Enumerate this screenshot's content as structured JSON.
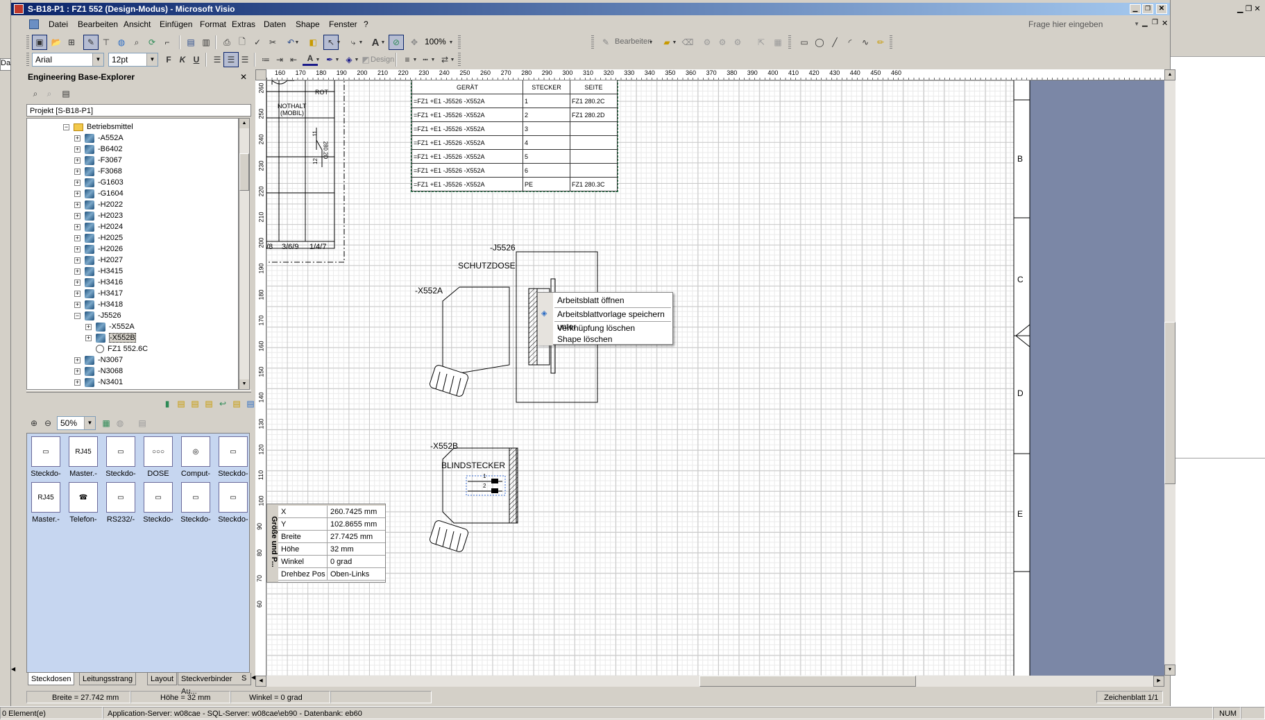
{
  "window": {
    "title": "S-B18-P1 : FZ1 552 (Design-Modus) - Microsoft Visio"
  },
  "menu": {
    "items": [
      "Datei",
      "Bearbeiten",
      "Ansicht",
      "Einfügen",
      "Format",
      "Extras",
      "Daten",
      "Shape",
      "Fenster",
      "?"
    ],
    "help_placeholder": "Frage hier eingeben"
  },
  "toolbar": {
    "zoom": "100%",
    "font": "Arial",
    "font_size": "12pt",
    "bearbeiten_label": "Bearbeiten",
    "design_label": "Design"
  },
  "explorer": {
    "title": "Engineering Base-Explorer",
    "project": "Projekt [S-B18-P1]",
    "root": "Betriebsmittel",
    "items": [
      "-A552A",
      "-B6402",
      "-F3067",
      "-F3068",
      "-G1603",
      "-G1604",
      "-H2022",
      "-H2023",
      "-H2024",
      "-H2025",
      "-H2026",
      "-H2027",
      "-H3415",
      "-H3416",
      "-H3417",
      "-H3418",
      "-J5526"
    ],
    "children": [
      "-X552A",
      "-X552B",
      "FZ1 552.6C"
    ],
    "after": [
      "-N3067",
      "-N3068",
      "-N3401"
    ]
  },
  "stencil": {
    "zoom": "50%",
    "row1": [
      {
        "label": "Steckdo-",
        "icon": "socket-icon"
      },
      {
        "label": "Master.-",
        "icon": "rj45-icon"
      },
      {
        "label": "Steckdo-",
        "icon": "socket-icon"
      },
      {
        "label": "DOSE",
        "icon": "dose-icon"
      },
      {
        "label": "Comput-",
        "icon": "computer-socket-icon"
      },
      {
        "label": "Steckdo-",
        "icon": "socket-icon"
      }
    ],
    "row2": [
      {
        "label": "Master.-",
        "icon": "rj45-icon"
      },
      {
        "label": "Telefon-",
        "icon": "telephone-icon"
      },
      {
        "label": "RS232/-",
        "icon": "rs232-icon"
      },
      {
        "label": "Steckdo-",
        "icon": "socket-icon"
      },
      {
        "label": "Steckdo-",
        "icon": "socket-icon"
      },
      {
        "label": "Steckdo-",
        "icon": "socket-icon"
      }
    ],
    "tabs": [
      "Steckdosen",
      "Leitungsstrang",
      "Layout",
      "Steckverbinder Au...",
      "S"
    ]
  },
  "ruler": {
    "top": [
      "160",
      "170",
      "180",
      "190",
      "200",
      "210",
      "220",
      "230",
      "240",
      "250",
      "260",
      "270",
      "280",
      "290",
      "300",
      "310",
      "320",
      "330",
      "340",
      "350",
      "360",
      "370",
      "380",
      "390",
      "400",
      "410",
      "420",
      "430",
      "440",
      "450",
      "460"
    ],
    "left": [
      "260",
      "250",
      "240",
      "230",
      "220",
      "210",
      "200",
      "190",
      "180",
      "170",
      "160",
      "150",
      "140",
      "130",
      "120",
      "110",
      "100",
      "90",
      "80",
      "70",
      "60"
    ]
  },
  "drawing": {
    "panel": {
      "rot": "ROT",
      "nothalt": "NOTHALT",
      "mobil": "(MOBIL)",
      "n11": "11",
      "n12": "12",
      "ref": "280.2D",
      "f1": "/8",
      "f2": "3/6/9",
      "f3": "1/4/7"
    },
    "table": {
      "headers": [
        "GERÄT",
        "STECKER",
        "SEITE"
      ],
      "rows": [
        [
          "=FZ1 +E1 -J5526 -X552A",
          "1",
          "FZ1 280.2C"
        ],
        [
          "=FZ1 +E1 -J5526 -X552A",
          "2",
          "FZ1 280.2D"
        ],
        [
          "=FZ1 +E1 -J5526 -X552A",
          "3",
          ""
        ],
        [
          "=FZ1 +E1 -J5526 -X552A",
          "4",
          ""
        ],
        [
          "=FZ1 +E1 -J5526 -X552A",
          "5",
          ""
        ],
        [
          "=FZ1 +E1 -J5526 -X552A",
          "6",
          ""
        ],
        [
          "=FZ1 +E1 -J5526 -X552A",
          "PE",
          "FZ1 280.3C"
        ]
      ]
    },
    "labels": {
      "j5526": "-J5526",
      "schutzdose": "SCHUTZDOSE",
      "x552a": "-X552A",
      "x552b": "-X552B",
      "blindstecker": "BLINDSTECKER",
      "pin1": "1",
      "pin2": "2"
    },
    "border_letters": [
      "B",
      "C",
      "D",
      "E"
    ]
  },
  "context_menu": {
    "items": [
      "Arbeitsblatt öffnen",
      "Arbeitsblattvorlage speichern unter",
      "Verknüpfung löschen",
      "Shape löschen"
    ]
  },
  "size_position": {
    "title": "Größe und P...",
    "rows": [
      {
        "label": "X",
        "value": "260.7425 mm"
      },
      {
        "label": "Y",
        "value": "102.8655 mm"
      },
      {
        "label": "Breite",
        "value": "27.7425 mm"
      },
      {
        "label": "Höhe",
        "value": "32 mm"
      },
      {
        "label": "Winkel",
        "value": "0 grad"
      },
      {
        "label": "Drehbez Pos",
        "value": "Oben-Links"
      }
    ]
  },
  "status": {
    "breite": "Breite = 27.742 mm",
    "hoehe": "Höhe = 32 mm",
    "winkel": "Winkel = 0 grad",
    "sheet": "Zeichenblatt 1/1",
    "elements": "0 Element(e)",
    "server": "Application-Server: w08cae - SQL-Server: w08cae\\eb90 - Datenbank: eb60",
    "num": "NUM",
    "side_tab": "Da"
  },
  "colors": {
    "titlebar_start": "#0a246a",
    "titlebar_end": "#a6caf0",
    "stencil_bg": "#c6d6f0",
    "drawing_right": "#7b87a6"
  }
}
